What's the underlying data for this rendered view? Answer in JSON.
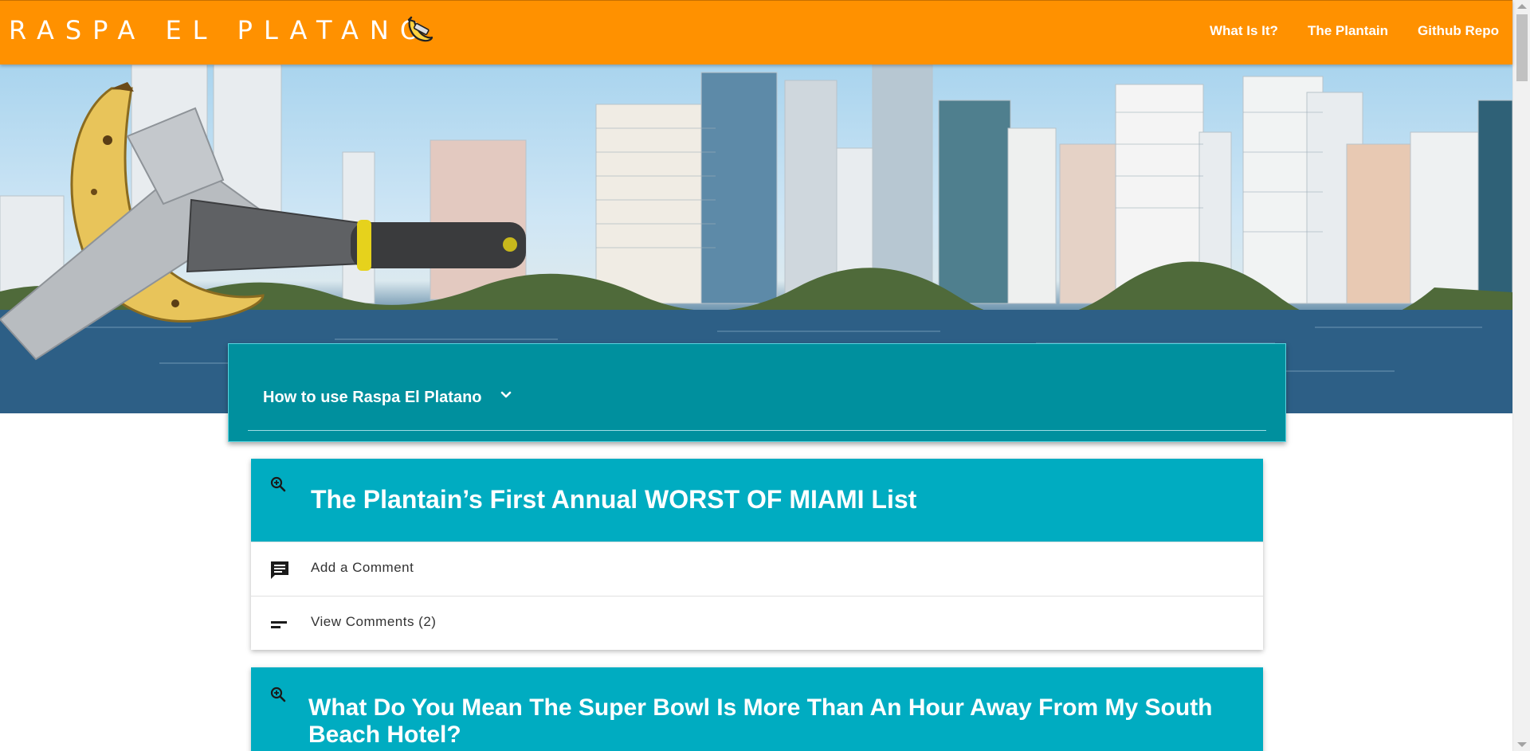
{
  "navbar": {
    "brand": "RASPA EL PLATANO",
    "links": [
      "What Is It?",
      "The Plantain",
      "Github Repo"
    ]
  },
  "howto": {
    "title": "How to use Raspa El Platano"
  },
  "cards": [
    {
      "title": "The Plantain’s First Annual WORST OF MIAMI List",
      "add_comment": "Add a Comment",
      "view_comments": "View Comments (2)"
    },
    {
      "title": "What Do You Mean The Super Bowl Is More Than An Hour Away From My South Beach Hotel?"
    }
  ],
  "colors": {
    "navbar": "#ff9100",
    "howto_panel": "#00909e",
    "card_header": "#00acc1"
  },
  "icons": [
    "banana-logo-icon",
    "chevron-down-icon",
    "zoom-in-icon",
    "comment-icon",
    "short-text-icon"
  ]
}
